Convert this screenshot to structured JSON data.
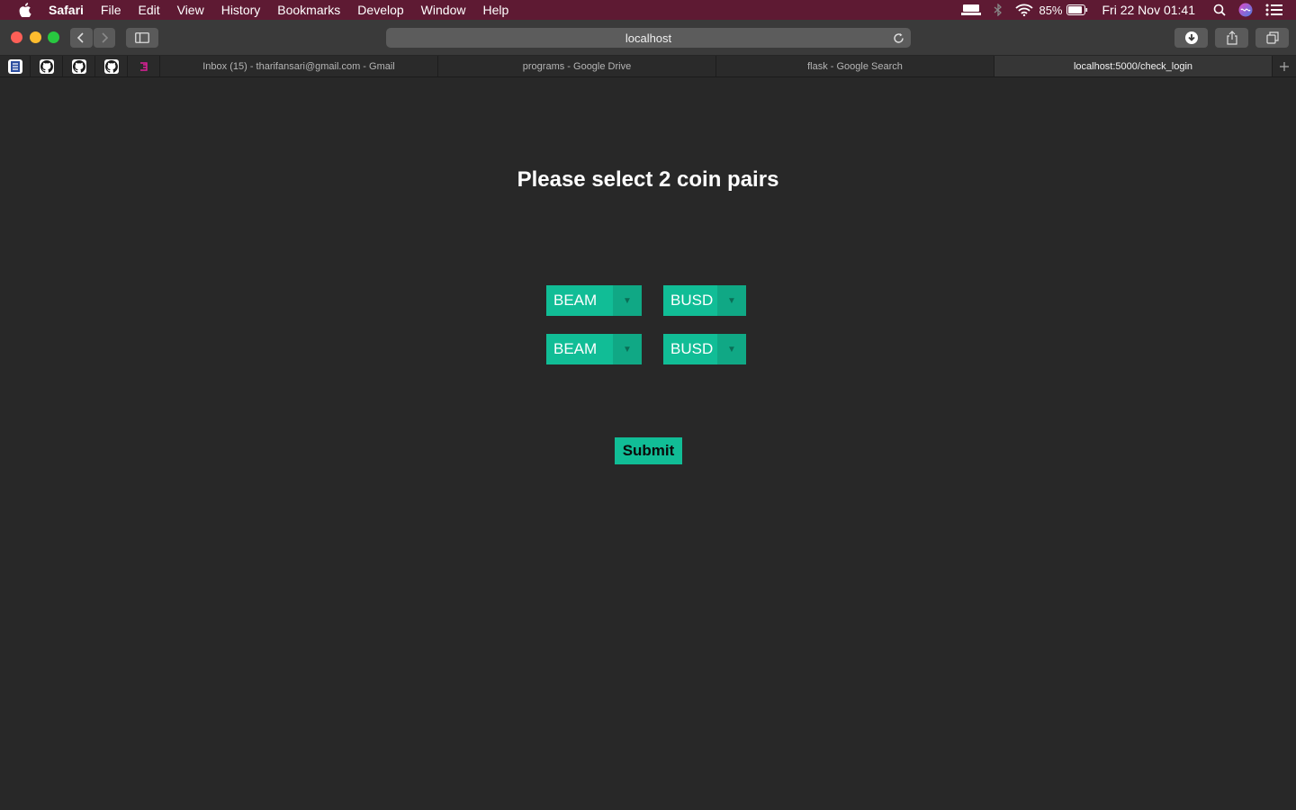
{
  "menubar": {
    "apple_icon": "apple-icon",
    "items": [
      "Safari",
      "File",
      "Edit",
      "View",
      "History",
      "Bookmarks",
      "Develop",
      "Window",
      "Help"
    ],
    "battery": "85%",
    "datetime": "Fri 22 Nov  01:41",
    "icons": [
      "display-icon",
      "bluetooth-icon",
      "wifi-icon",
      "battery-icon",
      "spotlight-icon",
      "siri-icon",
      "notification-center-icon"
    ]
  },
  "toolbar": {
    "address": "localhost"
  },
  "tabs": {
    "pinned": [
      "bookmark-icon",
      "github-icon",
      "github-icon",
      "github-icon",
      "app-icon"
    ],
    "items": [
      {
        "label": "Inbox (15) - tharifansari@gmail.com - Gmail",
        "active": false
      },
      {
        "label": "programs - Google Drive",
        "active": false
      },
      {
        "label": "flask - Google Search",
        "active": false
      },
      {
        "label": "localhost:5000/check_login",
        "active": true
      }
    ]
  },
  "page": {
    "heading": "Please select 2 coin pairs",
    "pairs": [
      {
        "base": "BEAM",
        "quote": "BUSD"
      },
      {
        "base": "BEAM",
        "quote": "BUSD"
      }
    ],
    "submit": "Submit"
  },
  "colors": {
    "menubar": "#5e1a33",
    "background": "#282828",
    "accent": "#11bd96"
  }
}
